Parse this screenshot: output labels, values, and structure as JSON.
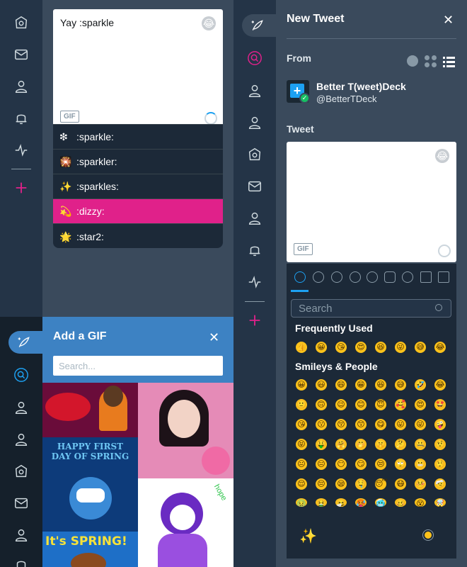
{
  "compose_top": {
    "text": "Yay :sparkle",
    "gif_label": "GIF"
  },
  "autocomplete": {
    "items": [
      {
        "label": ":sparkle:",
        "glyph": "❇"
      },
      {
        "label": ":sparkler:",
        "glyph": "🎇"
      },
      {
        "label": ":sparkles:",
        "glyph": "✨"
      },
      {
        "label": ":dizzy:",
        "glyph": "💫",
        "selected": true
      },
      {
        "label": ":star2:",
        "glyph": "🌟"
      }
    ],
    "selected_color": "#e0218a"
  },
  "gif_panel": {
    "title": "Add a GIF",
    "search_placeholder": "Search...",
    "header_color": "#3d82c3",
    "tiles": [
      {
        "text": ""
      },
      {
        "text": ""
      },
      {
        "text": "HAPPY FIRST DAY OF SPRING"
      },
      {
        "text": ""
      },
      {
        "text": "It's SPRING!"
      }
    ]
  },
  "tweet_panel": {
    "title": "New Tweet",
    "from_label": "From",
    "account_name": "Better T(weet)Deck",
    "account_handle": "@BetterTDeck",
    "tweet_label": "Tweet",
    "gif_label": "GIF"
  },
  "emoji_picker": {
    "search_placeholder": "Search",
    "frequently_used_title": "Frequently Used",
    "smileys_title": "Smileys & People",
    "categories": [
      "recent",
      "smileys",
      "animals",
      "food",
      "activity",
      "travel",
      "objects",
      "symbols",
      "flags"
    ]
  },
  "colors": {
    "accent": "#e0218a",
    "nav_bg": "#243447",
    "panel_bg": "#3a4a5c",
    "active_blue": "#1da1f2"
  }
}
